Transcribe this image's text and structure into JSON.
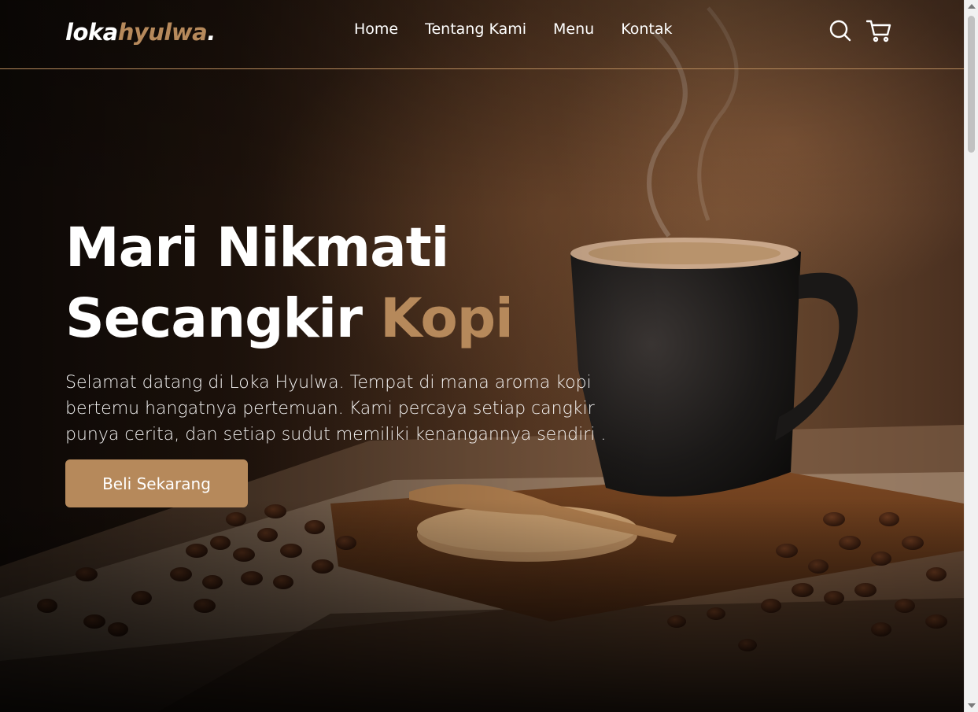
{
  "brand": {
    "logo_main": "loka",
    "logo_accent": "hyulwa",
    "logo_dot": "."
  },
  "nav": {
    "links": [
      {
        "label": "Home"
      },
      {
        "label": "Tentang Kami"
      },
      {
        "label": "Menu"
      },
      {
        "label": "Kontak"
      }
    ],
    "icons": [
      "search-icon",
      "shopping-cart-icon"
    ]
  },
  "hero": {
    "title_line1": "Mari Nikmati",
    "title_line2_main": "Secangkir ",
    "title_line2_accent": "Kopi",
    "description": "Selamat datang di Loka Hyulwa. Tempat di mana aroma kopi bertemu hangatnya pertemuan. Kami percaya setiap cangkir punya cerita, dan setiap sudut memiliki kenangannya sendiri .",
    "cta_label": "Beli Sekarang"
  },
  "colors": {
    "accent": "#b6895b",
    "text": "#ffffff"
  }
}
